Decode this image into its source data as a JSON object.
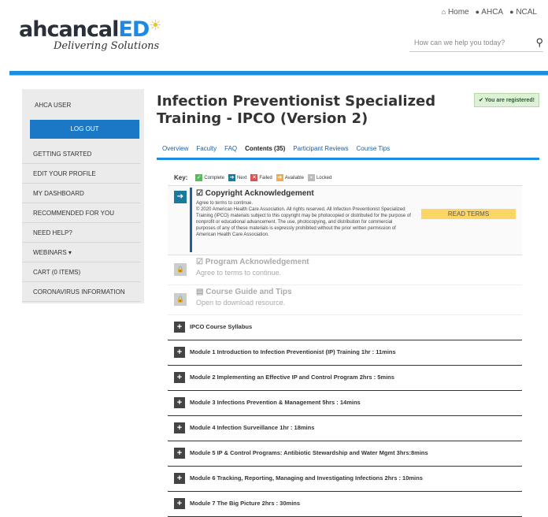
{
  "topnav": {
    "home": "Home",
    "ahca": "AHCA",
    "ncal": "NCAL"
  },
  "logo": {
    "brand_part1": "ahcancal",
    "brand_part2": "ED",
    "tagline": "Delivering Solutions"
  },
  "search": {
    "placeholder": "How can we help you today?"
  },
  "sidebar": {
    "user": "AHCA USER",
    "logout": "LOG OUT",
    "items": [
      {
        "label": "GETTING STARTED"
      },
      {
        "label": "EDIT YOUR PROFILE"
      },
      {
        "label": "MY DASHBOARD"
      },
      {
        "label": "RECOMMENDED FOR YOU"
      },
      {
        "label": "NEED HELP?"
      },
      {
        "label": "WEBINARS ▾"
      },
      {
        "label": "CART (0 ITEMS)"
      },
      {
        "label": "CORONAVIRUS INFORMATION"
      }
    ]
  },
  "main": {
    "title": "Infection Preventionist Specialized Training - IPCO (Version 2)",
    "registered": "✔ You are registered!",
    "tabs": [
      "Overview",
      "Faculty",
      "FAQ",
      "Contents (35)",
      "Participant Reviews",
      "Course Tips"
    ]
  },
  "key": {
    "label": "Key:",
    "complete": "Complete",
    "next": "Next",
    "failed": "Failed",
    "available": "Available",
    "locked": "Locked"
  },
  "copyright": {
    "heading": "Copyright Acknowledgement",
    "line1": "Agree to terms to continue.",
    "text": "© 2020 American Health Care Association. All rights reserved. All Infection Preventionist Specialized Training (IPCO) materials subject to this copyright may be photocopied or distributed for the purpose of nonprofit or educational advancement. The use, photocopying, and distribution for commercial purposes of any of these materials is expressly prohibited without the prior written permission of American Health Care Association.",
    "button": "READ TERMS"
  },
  "program": {
    "heading": "Program Acknowledgement",
    "sub": "Agree to terms to continue."
  },
  "guide": {
    "heading": "Course Guide and Tips",
    "sub": "Open to download resource."
  },
  "modules": [
    {
      "label": "IPCO Course Syllabus"
    },
    {
      "label": "Module 1 Introduction to Infection Preventionist (IP) Training 1hr : 11mins"
    },
    {
      "label": "Module 2 Implementing an Effective IP and Control Program 2hrs : 5mins"
    },
    {
      "label": "Module 3 Infections Prevention & Management 5hrs : 14mins"
    },
    {
      "label": "Module 4 Infection Surveillance 1hr : 18mins"
    },
    {
      "label": "Module 5 IP & Control Programs: Antibiotic Stewardship and Water Mgmt 3hrs:8mins"
    },
    {
      "label": "Module 6 Tracking, Reporting, Managing and Investigating Infections 2hrs : 10mins"
    },
    {
      "label": "Module 7 The Big Picture 2hrs : 30mins"
    }
  ]
}
